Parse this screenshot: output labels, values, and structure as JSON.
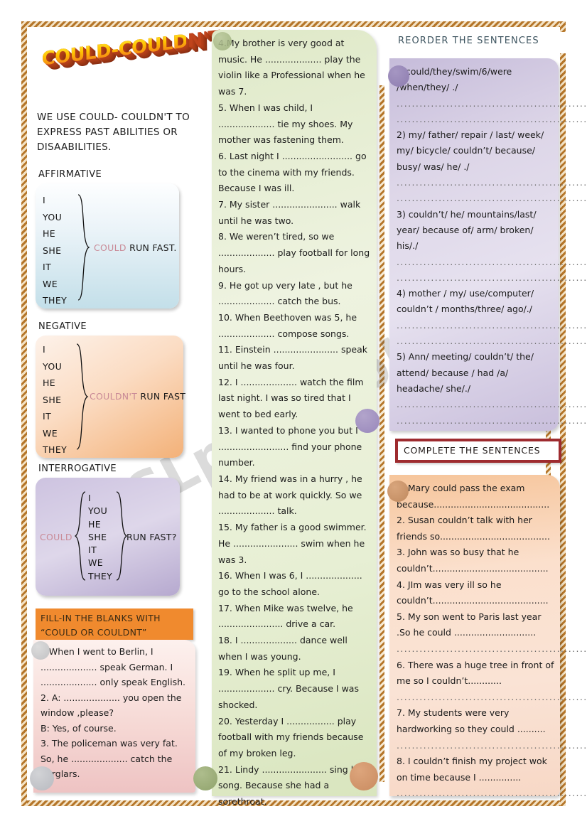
{
  "worksheet": {
    "title": "COULD-COULDN'T",
    "intro": "WE USE COULD- COULDN'T TO EXPRESS PAST ABILITIES OR DISAABILITIES.",
    "watermark": "ESLprintables.com"
  },
  "grammar": {
    "affirmative": {
      "heading": "AFFIRMATIVE",
      "pronouns": [
        "I",
        "YOU",
        "HE",
        "SHE",
        "IT",
        "WE",
        "THEY"
      ],
      "keyword": "COULD",
      "rest": " RUN FAST.",
      "bg_top": "#fdfeff",
      "bg_bottom": "#c3dfe9"
    },
    "negative": {
      "heading": "NEGATIVE",
      "pronouns": [
        "I",
        "YOU",
        "HE",
        "SHE",
        "IT",
        "WE",
        "THEY"
      ],
      "keyword": "COULDN'T",
      "rest": " RUN FAST",
      "bg_top": "#fdf2ea",
      "bg_bottom": "#f3b178"
    },
    "interrogative": {
      "heading": "INTERROGATIVE",
      "pronouns": [
        "I",
        "YOU",
        "HE",
        "SHE",
        "IT",
        "WE",
        "THEY"
      ],
      "keyword": "COULD",
      "rest": "RUN FAST?",
      "bg_top": "#cdc3e0",
      "bg_bottom": "#b6a9cf"
    }
  },
  "fill_in": {
    "banner_line1": "FILL-IN THE BLANKS WITH",
    "banner_line2": "“COULD OR COULDNT”",
    "banner_color": "#f08a2e",
    "items": [
      "1.When I went to Berlin, I .................... speak German. I .................... only speak English.",
      "2. A: .................... you open the window ,please?",
      "   B: Yes, of course.",
      "3. The policeman was very fat. So, he .................... catch the burglars."
    ]
  },
  "middle_column": {
    "items": [
      "4.My brother is very good at music. He .................... play the violin like a Professional when he was 7.",
      "5. When I was  child, I .................... tie my shoes. My mother was fastening them.",
      "6. Last night I ......................... go to the cinema with my friends. Because I was ill.",
      "7. My sister ....................... walk until he was two.",
      "8. We weren’t tired, so we .................... play football for long hours.",
      "9. He got up very late , but he .................... catch the bus.",
      "10. When Beethoven was 5, he .................... compose songs.",
      "11. Einstein ....................... speak until he was four.",
      "12. I .................... watch the film last night. I was so tired that I went to bed early.",
      "13. I wanted to phone you but I ......................... find your phone number.",
      "14. My friend was in a hurry , he had to be at work quickly. So we .................... talk.",
      "15. My father is a good swimmer. He ....................... swim when he was 3.",
      "16. When I was 6, I .................... go to the school alone.",
      "17. When Mike was twelve, he ....................... drive a car.",
      "18. I .................... dance well when I was young.",
      "19. When he split up me, I .................... cry. Because I was shocked.",
      "20. Yesterday I ................. play football with my friends because of my broken leg.",
      "21. Lindy ....................... sing her song. Because she had a sorethroat."
    ]
  },
  "reorder": {
    "heading": "REORDER THE SENTENCES",
    "heading_color": "#3e5560",
    "items": [
      "1)could/they/swim/6/were /when/they/ ./",
      "2) my/ father/ repair / last/ week/ my/ bicycle/ couldn’t/ because/ busy/ was/ he/  ./",
      "3) couldn’t/ he/ mountains/last/ year/ because of/ arm/ broken/ his/./",
      "4) mother / my/ use/computer/ couldn’t / months/three/ ago/./",
      "5) Ann/ meeting/ couldn’t/ the/ attend/ because / had /a/ headache/ she/./"
    ],
    "answer_line": "................................................................"
  },
  "complete": {
    "heading": "COMPLETE THE SENTENCES",
    "heading_border_color": "#9e2b2f",
    "items": [
      "1. Mary could pass the exam because.........................................",
      "2. Susan couldn’t talk with her friends  so.......................................",
      "3. John was so busy that he couldn’t.........................................",
      "4. JIm was very ill so he couldn’t.........................................",
      "5. My son went to Paris last year .So he could .............................",
      ".............................................................",
      "6. There was a huge tree in front of me so I couldn’t............",
      "..........................................................\"",
      "7.  My students were very hardworking so they could ..........",
      ".............................................................",
      "8. I couldn’t finish my project wok on time because I ...............",
      "............................................................."
    ]
  }
}
